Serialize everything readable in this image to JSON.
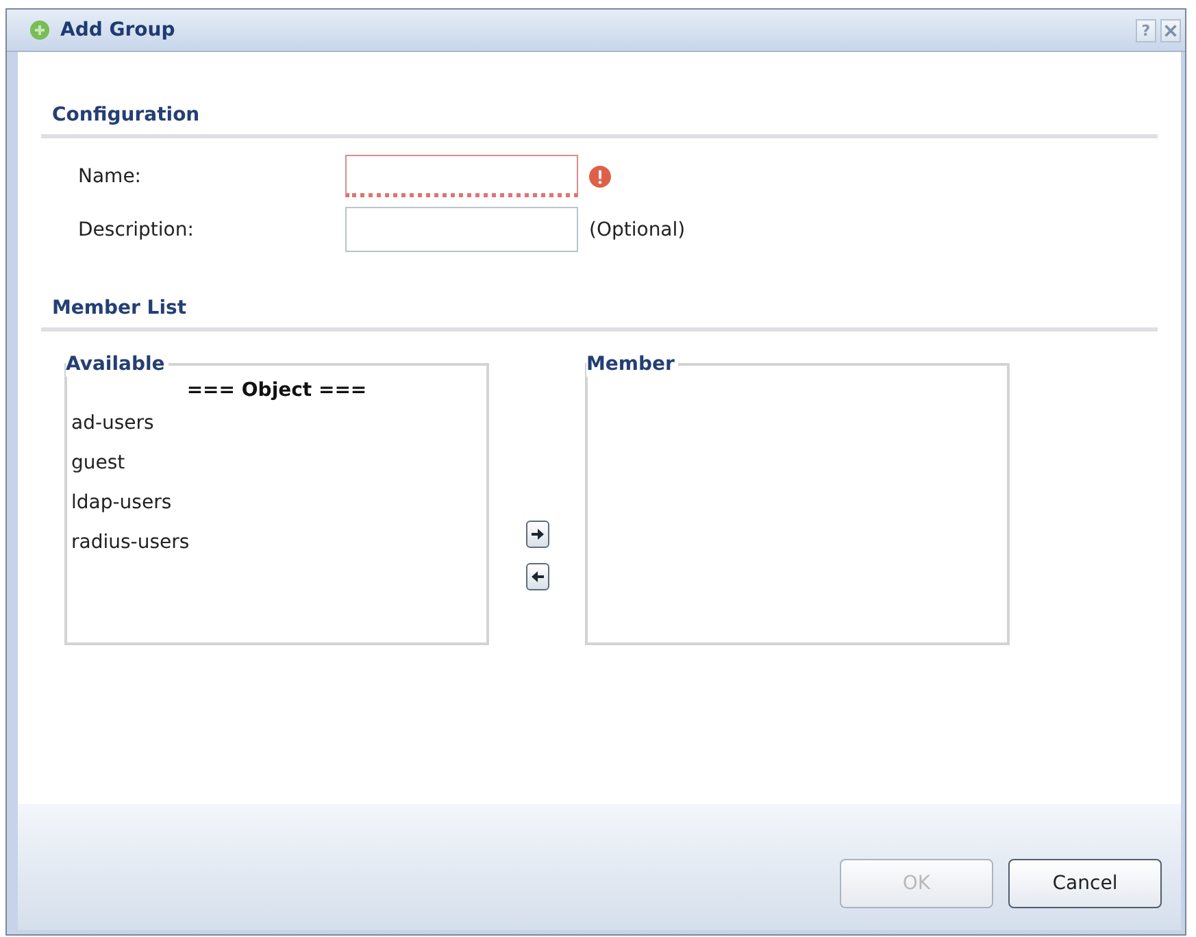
{
  "window": {
    "title": "Add Group",
    "help_label": "?"
  },
  "configuration": {
    "heading": "Configuration",
    "fields": [
      {
        "label": "Name:",
        "invalid": true
      },
      {
        "label": "Description:",
        "invalid": false,
        "note": "(Optional)"
      }
    ]
  },
  "member_list": {
    "heading": "Member List",
    "available": {
      "legend": "Available",
      "group_header": "=== Object ===",
      "items": [
        {
          "label": "ad-users",
          "selected": false
        },
        {
          "label": "guest",
          "selected": false
        },
        {
          "label": "ldap-users",
          "selected": false
        },
        {
          "label": "radius-users",
          "selected": false
        }
      ]
    },
    "member": {
      "legend": "Member"
    },
    "move_buttons": [
      {
        "kind": "add"
      },
      {
        "kind": "remove"
      }
    ]
  },
  "buttons": [
    {
      "label": "OK",
      "disabled": true
    },
    {
      "label": "Cancel",
      "disabled": false
    }
  ]
}
